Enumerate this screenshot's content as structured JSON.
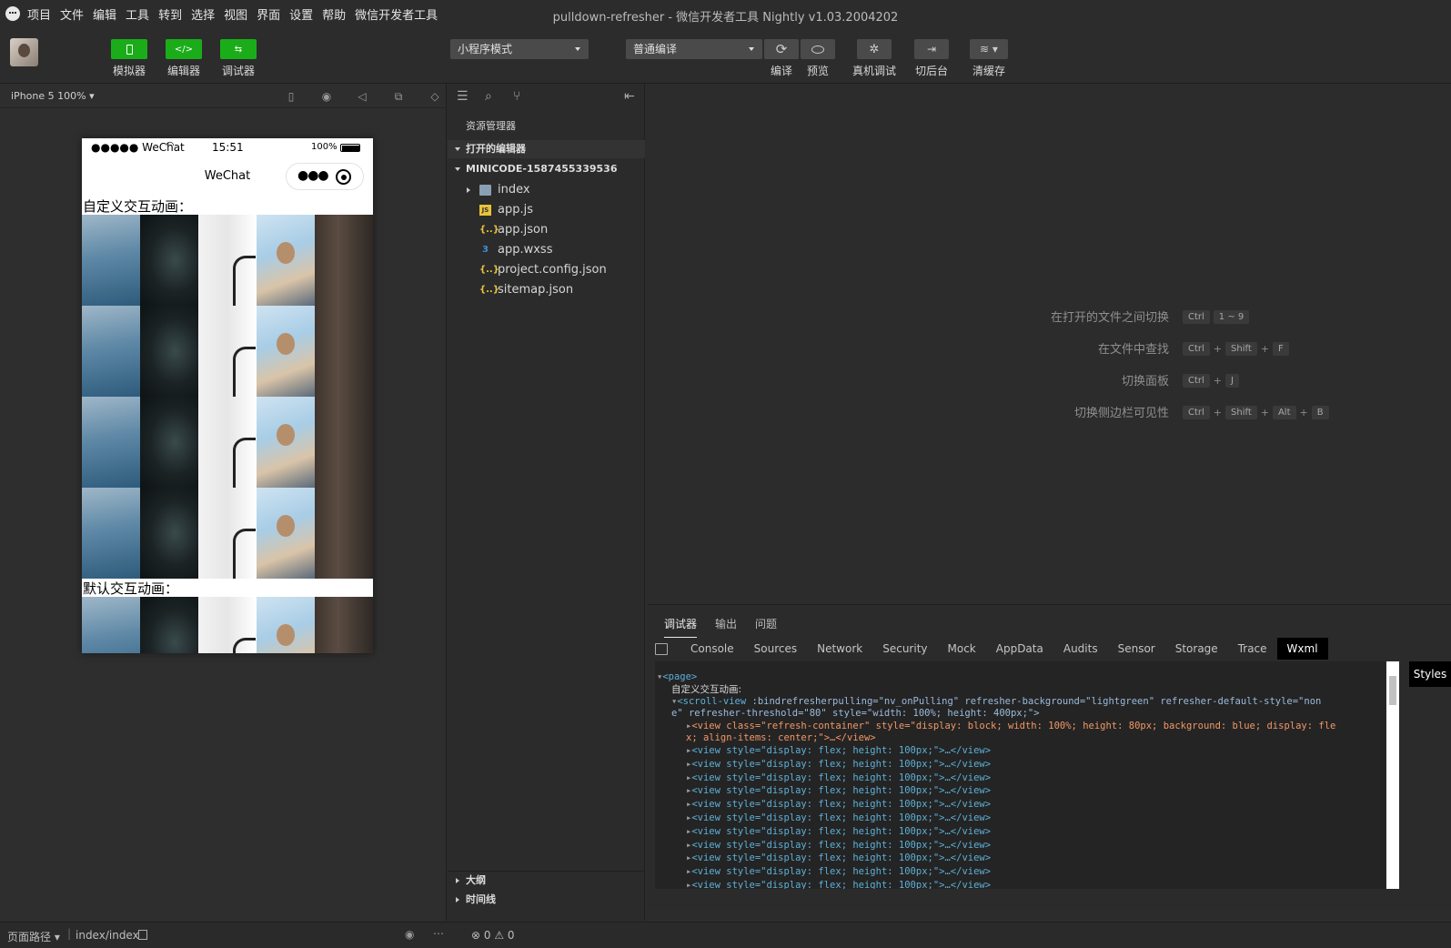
{
  "menu": [
    "项目",
    "文件",
    "编辑",
    "工具",
    "转到",
    "选择",
    "视图",
    "界面",
    "设置",
    "帮助",
    "微信开发者工具"
  ],
  "window_title": "pulldown-refresher - 微信开发者工具 Nightly v1.03.2004202",
  "toolbar": {
    "simulator_label": "模拟器",
    "editor_label": "编辑器",
    "debugger_label": "调试器",
    "mode_select": "小程序模式",
    "compile_select": "普通编译",
    "compile_label": "编译",
    "preview_label": "预览",
    "remote_debug_label": "真机调试",
    "background_label": "切后台",
    "clear_cache_label": "清缓存",
    "colors": {
      "accent": "#1aad19"
    }
  },
  "simulator": {
    "device": "iPhone 5 100%",
    "status": {
      "carrier": "●●●●● WeChat",
      "time": "15:51",
      "battery": "100%"
    },
    "nav_title": "WeChat",
    "section1_title": "自定义交互动画：",
    "section2_title": "默认交互动画："
  },
  "explorer": {
    "title": "资源管理器",
    "open_editors": "打开的编辑器",
    "project": "MINICODE-1587455339536",
    "files": [
      {
        "name": "index",
        "icon": "folder-icon"
      },
      {
        "name": "app.js",
        "icon": "js-file-icon"
      },
      {
        "name": "app.json",
        "icon": "json-file-icon"
      },
      {
        "name": "app.wxss",
        "icon": "css-file-icon"
      },
      {
        "name": "project.config.json",
        "icon": "json-file-icon"
      },
      {
        "name": "sitemap.json",
        "icon": "json-file-icon"
      }
    ],
    "outline": "大纲",
    "timeline": "时间线"
  },
  "shortcuts": [
    {
      "label": "在打开的文件之间切换",
      "keys": [
        "Ctrl",
        "1 ~ 9"
      ]
    },
    {
      "label": "在文件中查找",
      "keys": [
        "Ctrl",
        "+",
        "Shift",
        "+",
        "F"
      ]
    },
    {
      "label": "切换面板",
      "keys": [
        "Ctrl",
        "+",
        "J"
      ]
    },
    {
      "label": "切换侧边栏可见性",
      "keys": [
        "Ctrl",
        "+",
        "Shift",
        "+",
        "Alt",
        "+",
        "B"
      ]
    }
  ],
  "debugger": {
    "tabs": [
      "调试器",
      "输出",
      "问题"
    ],
    "devtools_tabs": [
      "Console",
      "Sources",
      "Network",
      "Security",
      "Mock",
      "AppData",
      "Audits",
      "Sensor",
      "Storage",
      "Trace",
      "Wxml"
    ],
    "styles_label": "Styles",
    "wxml": {
      "page_tag": "<page>",
      "text_node": "自定义交互动画:",
      "scroll_open": "<scroll-view",
      "scroll_attrs_1": ":bindrefresherpulling=\"nv_onPulling\" refresher-background=\"lightgreen\" refresher-default-style=\"non",
      "scroll_attrs_2": "e\" refresher-threshold=\"80\" style=\"width: 100%; height: 400px;\">",
      "refresh_line_1": "<view class=\"refresh-container\" style=\"display: block; width: 100%; height: 80px; background: blue; display: fle",
      "refresh_line_2": "x; align-items: center;\">…</view>",
      "view_line": "<view style=\"display: flex; height: 100px;\">…</view>"
    }
  },
  "statusbar": {
    "page_path_label": "页面路径",
    "page_path": "index/index",
    "errors": "0",
    "warnings": "0"
  }
}
